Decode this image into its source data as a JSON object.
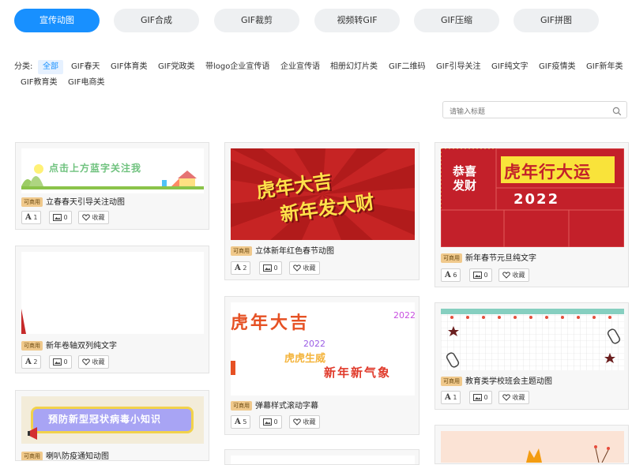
{
  "tabs": [
    {
      "label": "宣传动图",
      "active": true
    },
    {
      "label": "GIF合成"
    },
    {
      "label": "GIF裁剪"
    },
    {
      "label": "视频转GIF"
    },
    {
      "label": "GIF压缩"
    },
    {
      "label": "GIF拼图"
    }
  ],
  "categories": {
    "prefix": "分类:",
    "items": [
      "全部",
      "GIF春天",
      "GIF体育类",
      "GIF党政类",
      "带logo企业宣传语",
      "企业宣传语",
      "相册幻灯片类",
      "GIF二维码",
      "GIF引导关注",
      "GIF纯文字",
      "GIF疫情类",
      "GIF新年类",
      "GIF教育类",
      "GIF电商类"
    ]
  },
  "search": {
    "placeholder": "请输入标题"
  },
  "badge": "可商用",
  "fav_label": "收藏",
  "cards": [
    {
      "title": "立春春天引导关注动图",
      "uses": "1",
      "imgs": "0",
      "thumb_text": "点击上方蓝字关注我"
    },
    {
      "title": "新年卷轴双列纯文字",
      "uses": "2",
      "imgs": "0"
    },
    {
      "title": "喇叭防疫通知动图",
      "thumb_text": "预防新型冠状病毒小知识"
    },
    {
      "title": "立体新年红色春节动图",
      "uses": "2",
      "imgs": "0",
      "thumb_line1": "虎年大吉",
      "thumb_line2": "新年发大财"
    },
    {
      "title": "弹幕样式滚动字幕",
      "uses": "5",
      "imgs": "0",
      "thumb_l1": "虎年大吉",
      "thumb_l2": "2022",
      "thumb_l3": "虎虎生威",
      "thumb_l4": "新年新气象",
      "thumb_l5": "2022"
    },
    {
      "title": "新年春节元旦纯文字",
      "uses": "6",
      "imgs": "0",
      "thumb_t1": "恭喜",
      "thumb_t2": "发财",
      "thumb_t3": "虎年行大运",
      "thumb_t4": "2022"
    },
    {
      "title": "教育类学校班会主题动图",
      "uses": "1",
      "imgs": "0"
    }
  ],
  "colors": {
    "accent": "#1890ff",
    "badge": "#f0c98c",
    "red": "#c62a2a"
  }
}
